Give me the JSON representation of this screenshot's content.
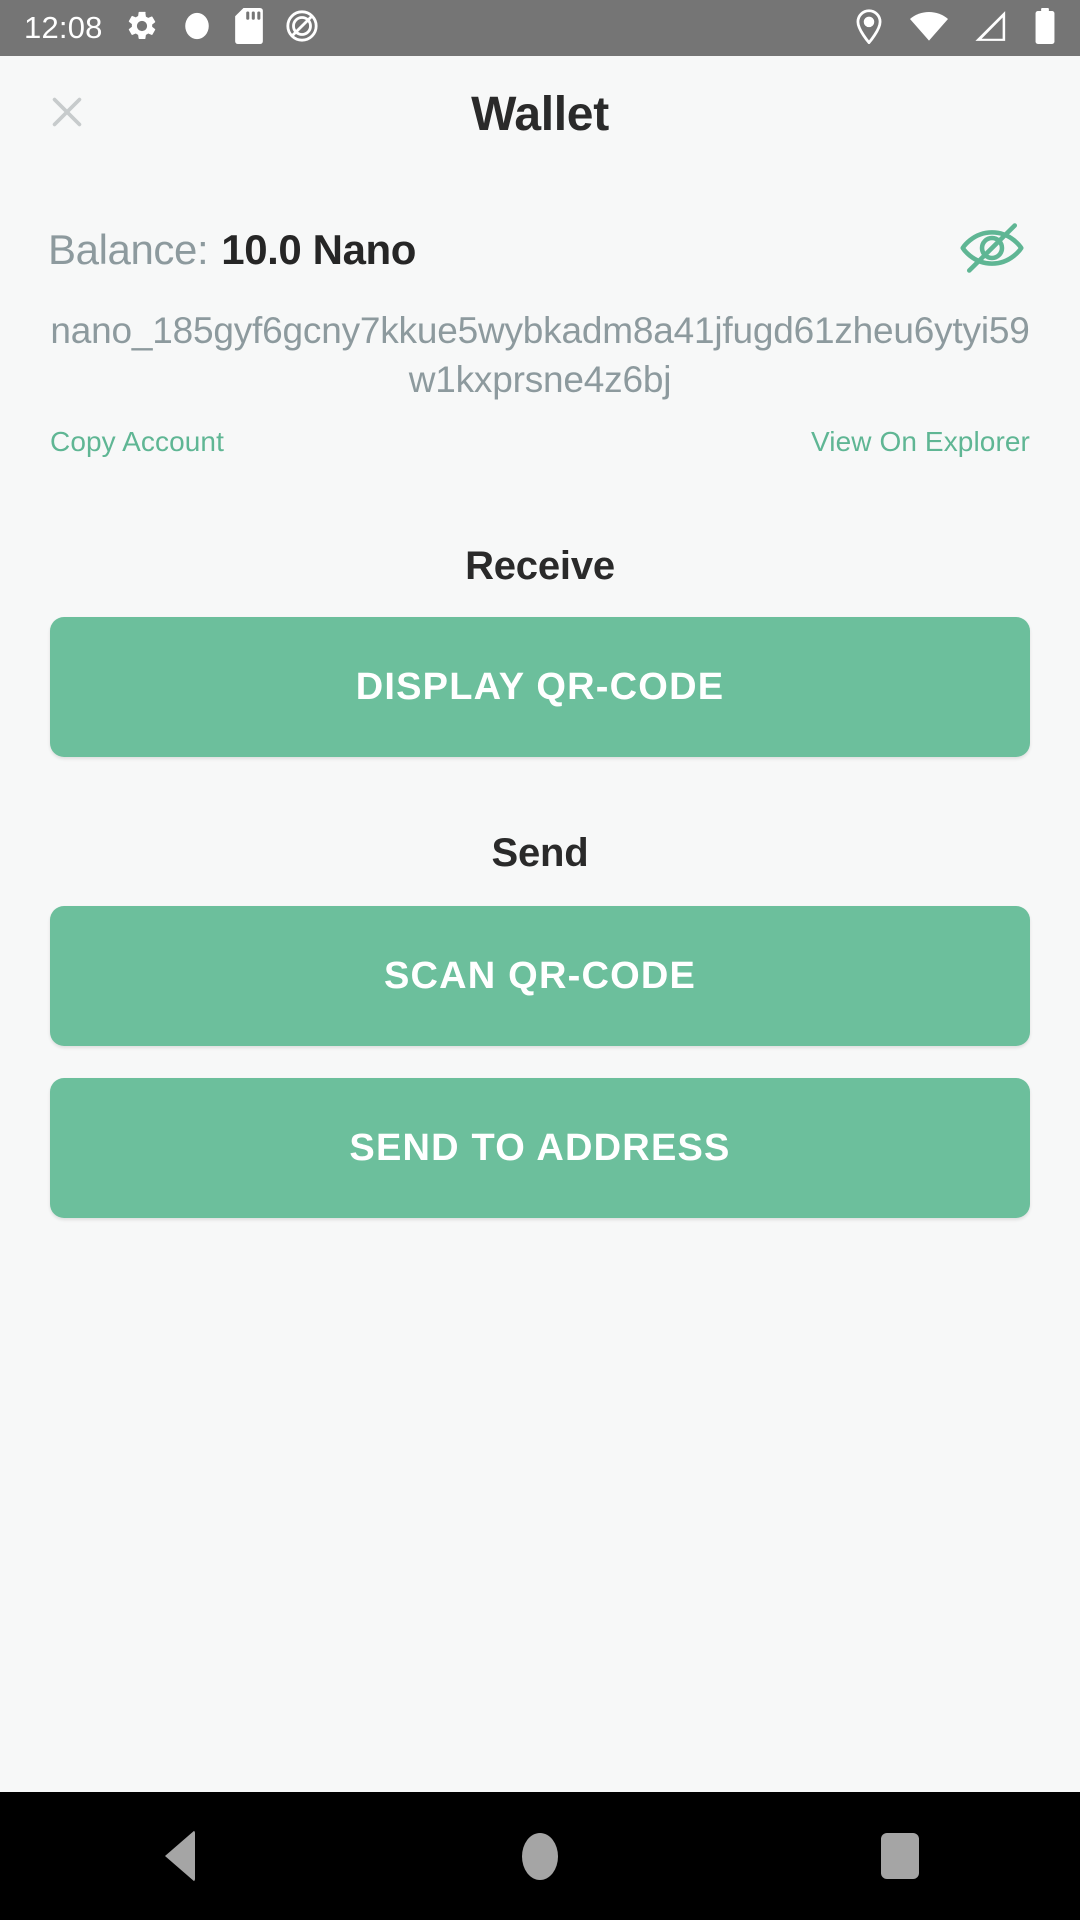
{
  "status_bar": {
    "clock": "12:08",
    "left_icons": [
      "settings-gear-icon",
      "circle-icon",
      "sd-card-icon",
      "do-not-disturb-icon"
    ],
    "right_icons": [
      "location-pin-icon",
      "wifi-icon",
      "cellular-signal-icon",
      "battery-icon"
    ],
    "background_color": "#757575",
    "icon_color": "#ffffff"
  },
  "appbar": {
    "title": "Wallet",
    "close_icon": "close-icon"
  },
  "balance": {
    "label": "Balance:",
    "value": "10.0 Nano",
    "visibility_icon": "eye-off-icon",
    "label_color": "#8d9a9e",
    "value_color": "#262626"
  },
  "account": {
    "address": "nano_185gyf6gcny7kkue5wybkadm8a41jfugd61zheu6ytyi59w1kxprsne4z6bj",
    "copy_link": "Copy Account",
    "explorer_link": "View On Explorer",
    "link_color": "#5fb694"
  },
  "receive": {
    "title": "Receive",
    "display_qr_button": "DISPLAY QR-CODE"
  },
  "send": {
    "title": "Send",
    "scan_qr_button": "SCAN QR-CODE",
    "send_address_button": "SEND TO ADDRESS"
  },
  "theme": {
    "accent": "#6cbf9c",
    "page_background": "#f7f8f8",
    "button_text": "#ffffff"
  },
  "nav_bar": {
    "items": [
      "back-button",
      "home-button",
      "recents-button"
    ],
    "background_color": "#000000",
    "icon_color": "#a5a5a5"
  }
}
